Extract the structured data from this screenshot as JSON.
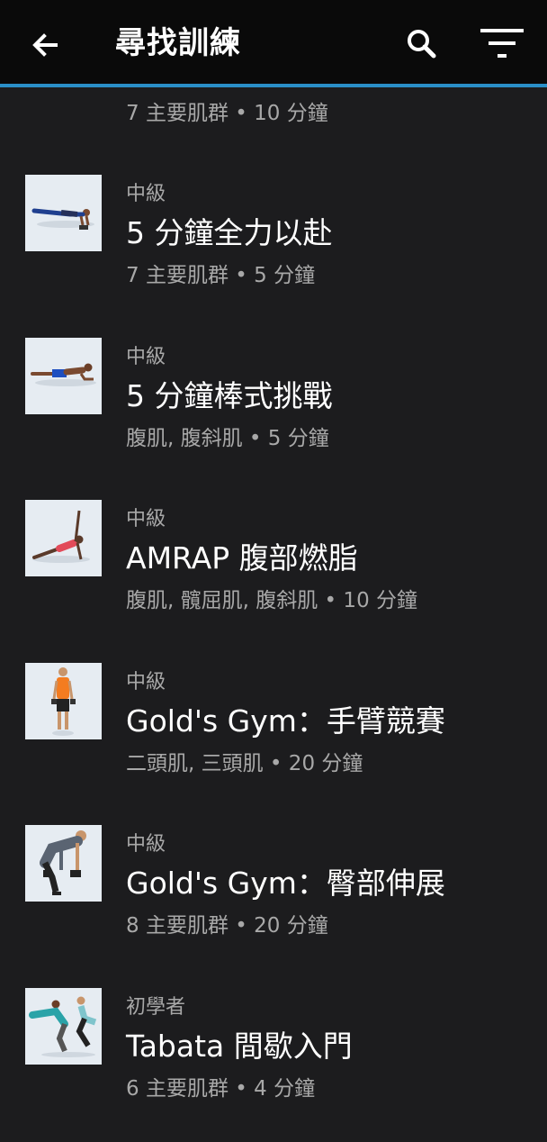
{
  "header": {
    "title": "尋找訓練",
    "back_icon": "arrow-back-icon",
    "search_icon": "search-icon",
    "filter_icon": "filter-icon"
  },
  "partial_item": {
    "meta": "7 主要肌群 • 10 分鐘"
  },
  "workouts": [
    {
      "level": "中級",
      "name": "5 分鐘全力以赴",
      "meta": "7 主要肌群 • 5 分鐘"
    },
    {
      "level": "中級",
      "name": "5 分鐘棒式挑戰",
      "meta": "腹肌, 腹斜肌 • 5 分鐘"
    },
    {
      "level": "中級",
      "name": "AMRAP 腹部燃脂",
      "meta": "腹肌, 髖屈肌, 腹斜肌 • 10 分鐘"
    },
    {
      "level": "中級",
      "name": "Gold's Gym：手臂競賽",
      "meta": "二頭肌, 三頭肌 • 20 分鐘"
    },
    {
      "level": "中級",
      "name": "Gold's Gym：臀部伸展",
      "meta": "8 主要肌群 • 20 分鐘"
    },
    {
      "level": "初學者",
      "name": "Tabata 間歇入門",
      "meta": "6 主要肌群 • 4 分鐘"
    }
  ],
  "colors": {
    "accent": "#2a8fc8",
    "background": "#1c1c1e",
    "appbar": "#0a0a0a"
  }
}
